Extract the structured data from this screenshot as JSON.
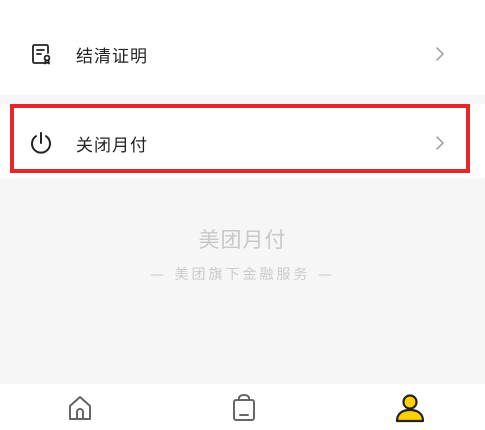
{
  "menu": {
    "items": [
      {
        "label": "结清证明",
        "icon": "certificate-icon"
      },
      {
        "label": "关闭月付",
        "icon": "power-icon"
      }
    ]
  },
  "brand": {
    "title": "美团月付",
    "subtitle": "— 美团旗下金融服务 —"
  },
  "tabbar": {
    "tabs": [
      {
        "icon": "home-icon",
        "active": false
      },
      {
        "icon": "shopping-bag-icon",
        "active": false
      },
      {
        "icon": "user-icon",
        "active": true
      }
    ]
  },
  "colors": {
    "accent": "#FFD100",
    "highlight": "#E5262B",
    "muted_text": "#C8C8C8"
  }
}
